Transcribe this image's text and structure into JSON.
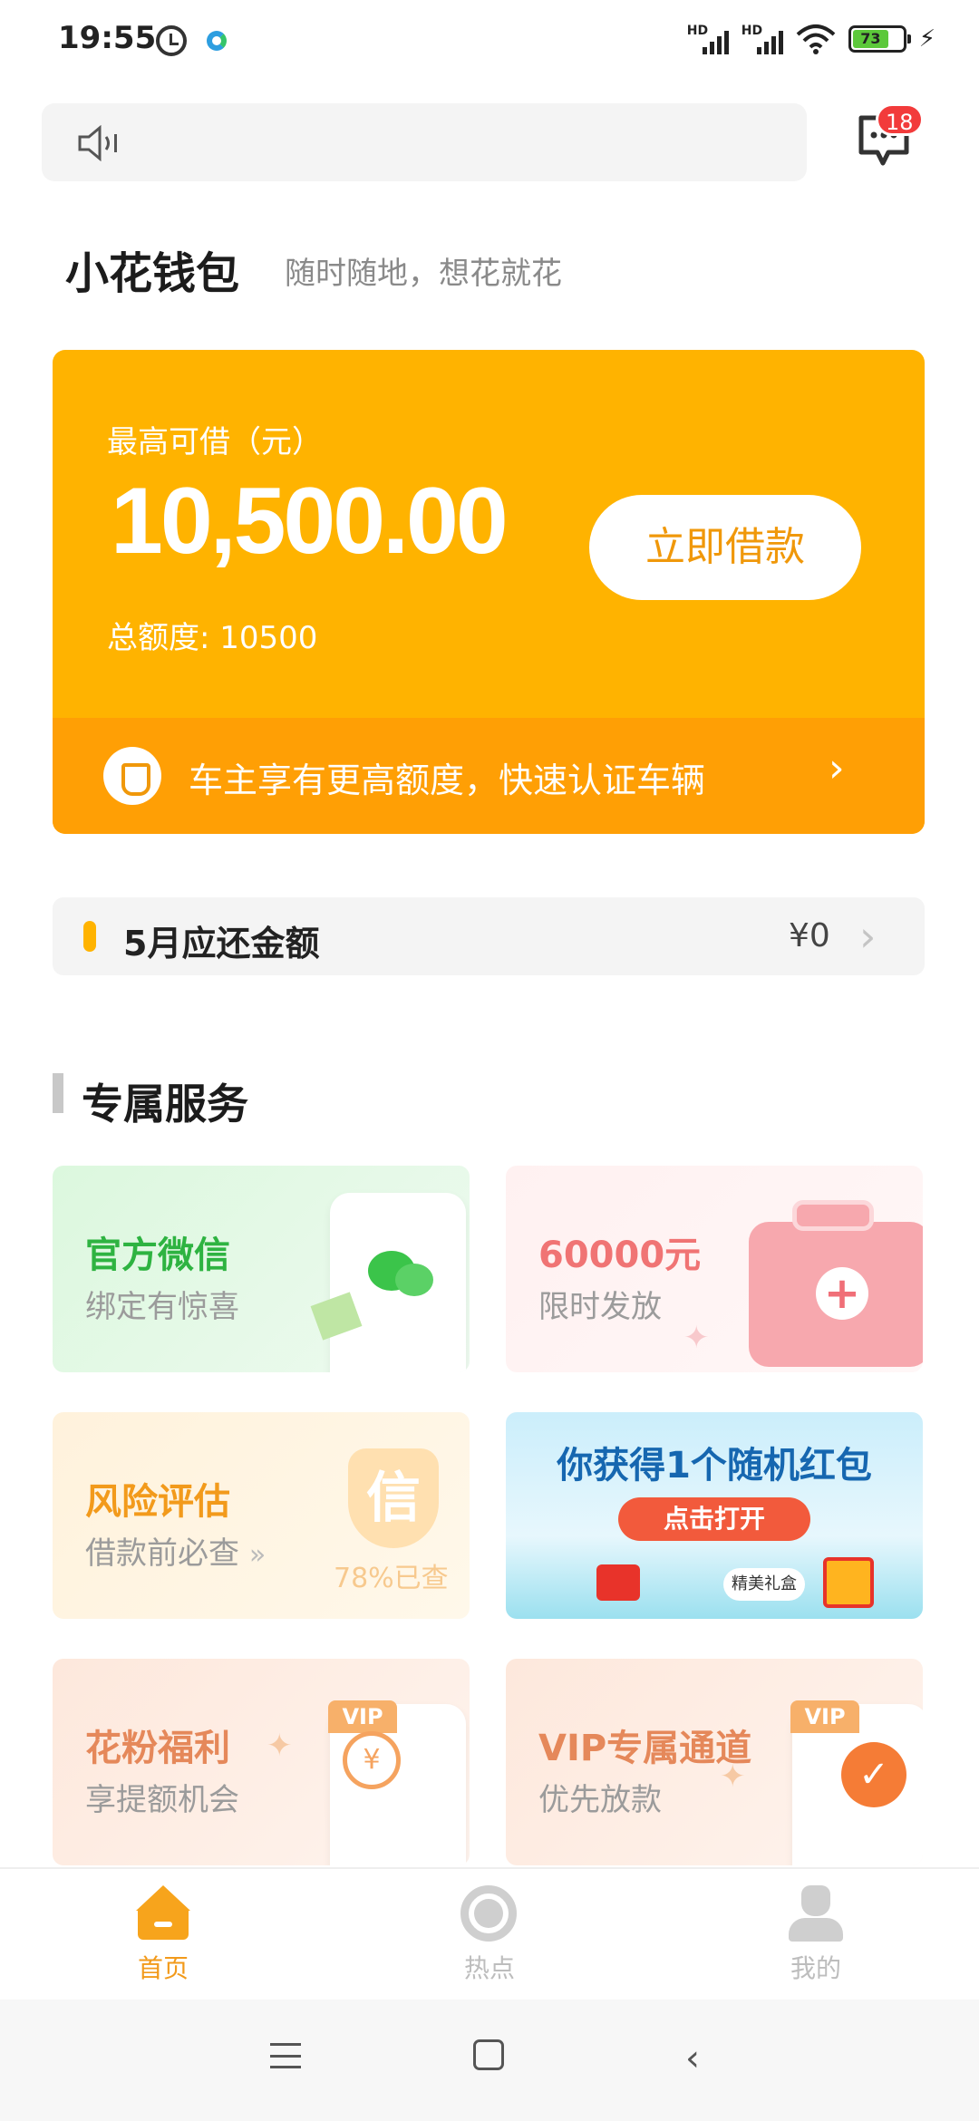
{
  "status_bar": {
    "time": "19:55",
    "battery": "73",
    "icons": [
      "alarm-icon",
      "app-status-icon",
      "hd-signal-icon",
      "hd-signal-icon",
      "wifi-icon",
      "battery-icon",
      "charging-icon"
    ]
  },
  "top_bar": {
    "notice_text": "",
    "message_badge": "18"
  },
  "brand": {
    "name": "小花钱包",
    "slogan": "随时随地，想花就花"
  },
  "loan_card": {
    "label": "最高可借（元）",
    "amount": "10,500.00",
    "total_label": "总额度: 10500",
    "borrow_button": "立即借款",
    "banner_text": "车主享有更高额度，快速认证车辆",
    "colors": {
      "card": "#ffb300",
      "banner": "#ff9f05"
    }
  },
  "repayment": {
    "title": "5月应还金额",
    "value": "¥0"
  },
  "services": {
    "section_title": "专属服务",
    "cards": [
      {
        "title": "官方微信",
        "subtitle": "绑定有惊喜",
        "icon": "wechat-icon"
      },
      {
        "title": "60000元",
        "subtitle": "限时发放",
        "icon": "medical-box-icon"
      },
      {
        "title": "风险评估",
        "subtitle": "借款前必查",
        "badge": "信",
        "percent": "78%已查",
        "icon": "credit-shield-icon"
      },
      {
        "title": "你获得1个随机红包",
        "button": "点击打开",
        "gift_label": "精美礼盒",
        "icon": "red-packet-icon"
      },
      {
        "title": "花粉福利",
        "subtitle": "享提额机会",
        "tag": "VIP",
        "icon": "yen-coin-icon"
      },
      {
        "title": "VIP专属通道",
        "subtitle": "优先放款",
        "tag": "VIP",
        "icon": "check-coin-icon"
      }
    ]
  },
  "tabs": [
    {
      "label": "首页",
      "icon": "home-icon",
      "active": true
    },
    {
      "label": "热点",
      "icon": "hot-icon",
      "active": false
    },
    {
      "label": "我的",
      "icon": "profile-icon",
      "active": false
    }
  ],
  "accent_color": "#f29a1b"
}
